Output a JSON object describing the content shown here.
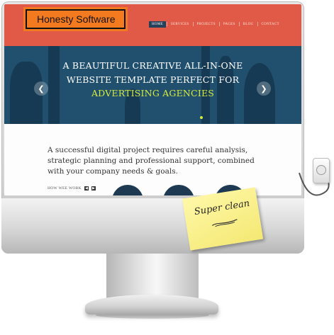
{
  "brand": {
    "name": "Honesty Software"
  },
  "nav": {
    "items": [
      {
        "label": "HOME"
      },
      {
        "label": "SERVICES"
      },
      {
        "label": "PROJECTS"
      },
      {
        "label": "PAGES"
      },
      {
        "label": "BLOG"
      },
      {
        "label": "CONTACT"
      }
    ]
  },
  "hero": {
    "line1": "A BEAUTIFUL CREATIVE ALL-IN-ONE",
    "line2": "WEBSITE TEMPLATE PERFECT FOR",
    "line3": "ADVERTISING AGENCIES",
    "prev_icon": "chevron-left-icon",
    "next_icon": "chevron-right-icon"
  },
  "content": {
    "intro": "A successful digital project requires careful analysis, strategic planning and professional support, combined with your company needs & goals.",
    "how_label": "HOW WEE WORK",
    "prev_icon": "caret-left-icon",
    "next_icon": "caret-right-icon"
  },
  "sticky_note": {
    "text": "Super clean"
  },
  "colors": {
    "header_bg": "#e15a47",
    "hero_bg": "#21506f",
    "hero_accent": "#d4ec3c",
    "brand_bg": "#f37a1f"
  }
}
